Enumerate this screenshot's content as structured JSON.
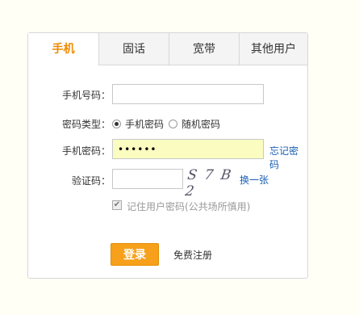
{
  "tabs": [
    {
      "label": "手机",
      "active": true
    },
    {
      "label": "固话",
      "active": false
    },
    {
      "label": "宽带",
      "active": false
    },
    {
      "label": "其他用户",
      "active": false
    }
  ],
  "form": {
    "phone_label": "手机号码：",
    "phone_value": "",
    "pwtype_label": "密码类型：",
    "pwtype_options": [
      "手机密码",
      "随机密码"
    ],
    "pwtype_selected": "手机密码",
    "password_label": "手机密码：",
    "password_value": "••••••",
    "forgot_link": "忘记密码",
    "captcha_label": "验证码：",
    "captcha_value": "",
    "captcha_text": "S 7 B 2",
    "refresh_link": "换一张",
    "remember_text": "记住用户密码(公共场所慎用)",
    "remember_checked": true,
    "login_button": "登录",
    "register_link": "免费注册"
  },
  "colors": {
    "accent": "#f08a00",
    "button": "#f7a01b",
    "link": "#1a5fb4",
    "password_bg": "#fafcc0"
  }
}
